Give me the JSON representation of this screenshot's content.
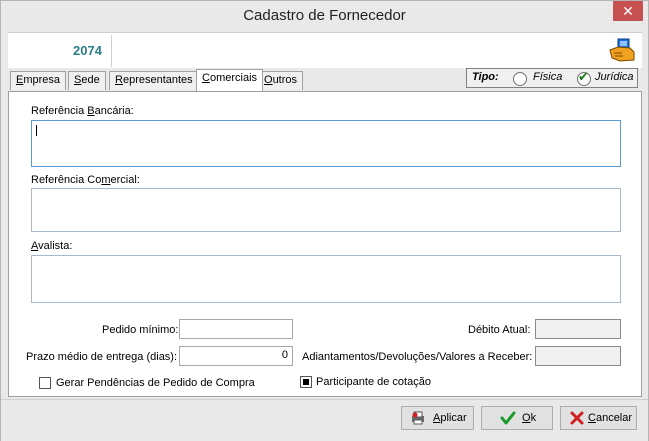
{
  "window": {
    "title": "Cadastro de Fornecedor",
    "close_glyph": "✕"
  },
  "header": {
    "code": "2074",
    "icon": "hand-card-icon"
  },
  "tabs": [
    {
      "label_pre": "",
      "label_u": "E",
      "label_post": "mpresa",
      "active": false
    },
    {
      "label_pre": "",
      "label_u": "S",
      "label_post": "ede",
      "active": false
    },
    {
      "label_pre": "",
      "label_u": "R",
      "label_post": "epresentantes",
      "active": false
    },
    {
      "label_pre": "",
      "label_u": "C",
      "label_post": "omerciais",
      "active": true
    },
    {
      "label_pre": "",
      "label_u": "O",
      "label_post": "utros",
      "active": false
    }
  ],
  "tipo": {
    "label": "Tipo:",
    "options": [
      {
        "label": "Física",
        "selected": false
      },
      {
        "label": "Jurídica",
        "selected": true
      }
    ]
  },
  "form": {
    "ref_bancaria": {
      "label_pre": "Referência ",
      "label_u": "B",
      "label_post": "ancária:",
      "value": ""
    },
    "ref_comercial": {
      "label_pre": "Referência Co",
      "label_u": "m",
      "label_post": "ercial:",
      "value": ""
    },
    "avalista": {
      "label_pre": "",
      "label_u": "A",
      "label_post": "valista:",
      "value": ""
    },
    "pedido_minimo": {
      "label": "Pedido mínimo:",
      "value": ""
    },
    "prazo_medio": {
      "label": "Prazo médio de entrega (dias):",
      "value": "0"
    },
    "debito_atual": {
      "label": "Débito Atual:",
      "value": ""
    },
    "adiantamentos": {
      "label": "Adiantamentos/Devoluções/Valores a Receber:",
      "value": ""
    },
    "gerar_pendencias": {
      "label": "Gerar Pendências de Pedido de Compra",
      "checked": false
    },
    "participante_cotacao": {
      "label": "Participante de cotação",
      "checked": true
    }
  },
  "footer": {
    "aplicar": {
      "label_pre": "",
      "label_u": "A",
      "label_post": "plicar",
      "icon": "apply-printer-icon"
    },
    "ok": {
      "label_pre": "",
      "label_u": "O",
      "label_post": "k",
      "icon": "green-check-icon"
    },
    "cancelar": {
      "label_pre": "",
      "label_u": "C",
      "label_post": "ancelar",
      "icon": "red-x-icon"
    }
  },
  "colors": {
    "code": "#2e7d8a",
    "close": "#c75050",
    "focus_border": "#5b9bd5"
  }
}
